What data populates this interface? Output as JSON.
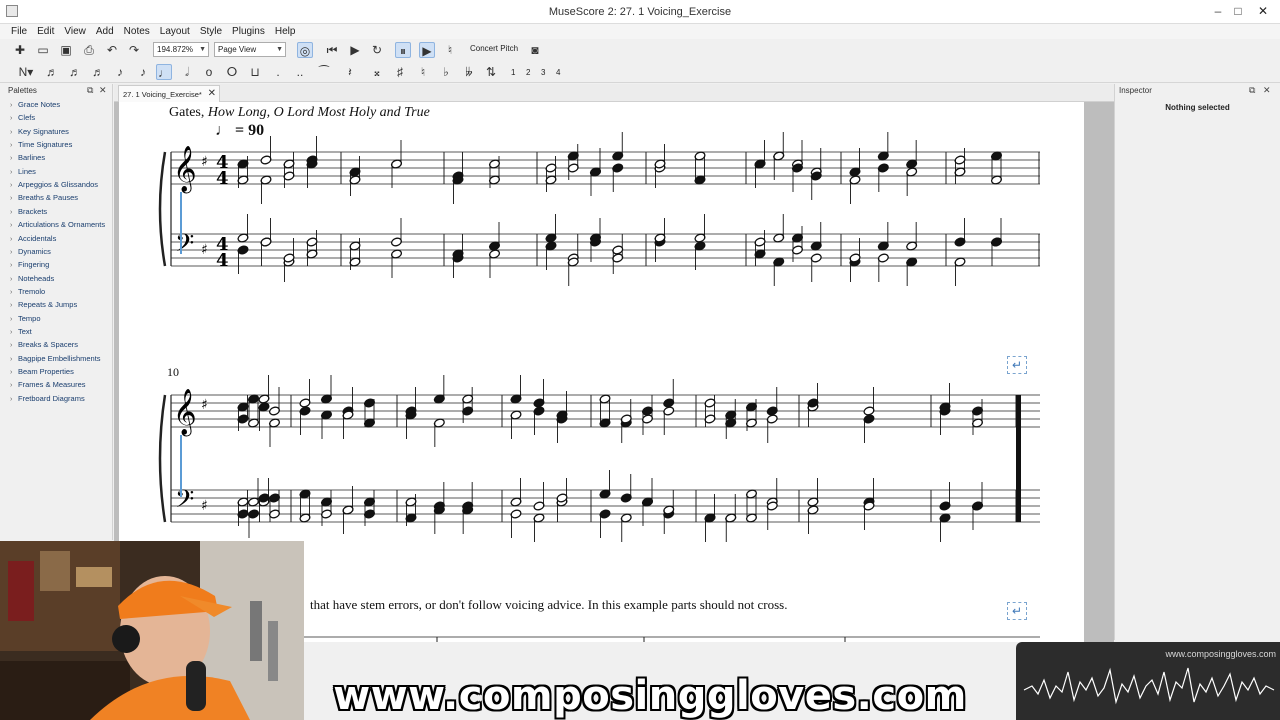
{
  "window": {
    "title": "MuseScore 2: 27. 1 Voicing_Exercise",
    "controls": {
      "minimize": "–",
      "maximize": "□",
      "close": "✕"
    }
  },
  "menu": [
    "File",
    "Edit",
    "View",
    "Add",
    "Notes",
    "Layout",
    "Style",
    "Plugins",
    "Help"
  ],
  "toolbar": {
    "zoom": "194.872%",
    "view_mode": "Page View",
    "concert_pitch": "Concert Pitch",
    "voices": [
      "1",
      "2",
      "3",
      "4"
    ]
  },
  "palettes": {
    "title": "Palettes",
    "items": [
      "Grace Notes",
      "Clefs",
      "Key Signatures",
      "Time Signatures",
      "Barlines",
      "Lines",
      "Arpeggios & Glissandos",
      "Breaths & Pauses",
      "Brackets",
      "Articulations & Ornaments",
      "Accidentals",
      "Dynamics",
      "Fingering",
      "Noteheads",
      "Tremolo",
      "Repeats & Jumps",
      "Tempo",
      "Text",
      "Breaks & Spacers",
      "Bagpipe Embellishments",
      "Beam Properties",
      "Frames & Measures",
      "Fretboard Diagrams"
    ]
  },
  "score_tab": {
    "label": "27. 1 Voicing_Exercise*",
    "close": "✕"
  },
  "score": {
    "title_plain": "Gates, ",
    "title_italic": "How Long, O Lord Most Holy and True",
    "tempo": "♩ = 90",
    "measure_number": "10",
    "instructions": "that have stem errors, or don't follow voicing advice. In this example parts should not cross."
  },
  "inspector": {
    "title": "Inspector",
    "status": "Nothing selected"
  },
  "overlay": {
    "wave_url": "www.composinggloves.com",
    "banner": "www.composinggloves.com"
  },
  "colors": {
    "page": "#ffffff",
    "canvas": "#bdbdbd",
    "selection_blue": "#5b9bd5",
    "chrome": "#f0f0f0"
  }
}
